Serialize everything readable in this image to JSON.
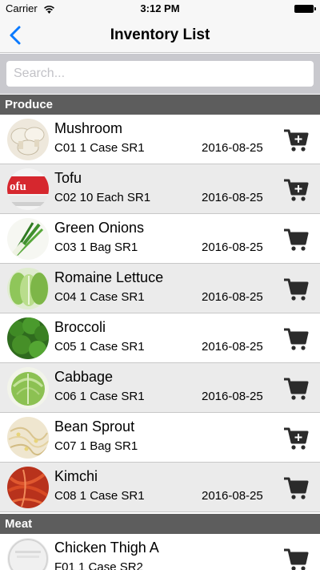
{
  "status_bar": {
    "carrier": "Carrier",
    "time": "3:12 PM"
  },
  "nav": {
    "title": "Inventory List",
    "back_icon": "chevron-left-icon",
    "tint_color": "#0a7aff"
  },
  "search": {
    "placeholder": "Search...",
    "value": ""
  },
  "sections": [
    {
      "name": "Produce",
      "items": [
        {
          "name": "Mushroom",
          "detail": "C01 1 Case SR1",
          "date": "2016-08-25",
          "cart_icon": "cart-plus-icon",
          "image": "mushroom"
        },
        {
          "name": "Tofu",
          "detail": "C02 10 Each SR1",
          "date": "2016-08-25",
          "cart_icon": "cart-plus-icon",
          "image": "tofu"
        },
        {
          "name": "Green Onions",
          "detail": "C03 1 Bag SR1",
          "date": "2016-08-25",
          "cart_icon": "cart-icon",
          "image": "green-onions"
        },
        {
          "name": "Romaine Lettuce",
          "detail": "C04 1 Case SR1",
          "date": "2016-08-25",
          "cart_icon": "cart-icon",
          "image": "romaine-lettuce"
        },
        {
          "name": "Broccoli",
          "detail": "C05 1 Case SR1",
          "date": "2016-08-25",
          "cart_icon": "cart-icon",
          "image": "broccoli"
        },
        {
          "name": "Cabbage",
          "detail": "C06 1 Case SR1",
          "date": "2016-08-25",
          "cart_icon": "cart-icon",
          "image": "cabbage"
        },
        {
          "name": "Bean Sprout",
          "detail": "C07 1 Bag SR1",
          "date": "",
          "cart_icon": "cart-plus-icon",
          "image": "bean-sprout"
        },
        {
          "name": "Kimchi",
          "detail": "C08 1 Case SR1",
          "date": "2016-08-25",
          "cart_icon": "cart-icon",
          "image": "kimchi"
        }
      ]
    },
    {
      "name": "Meat",
      "items": [
        {
          "name": "Chicken Thigh A",
          "detail": "F01 1 Case SR2",
          "date": "",
          "cart_icon": "cart-icon",
          "image": "no-image"
        }
      ]
    }
  ]
}
